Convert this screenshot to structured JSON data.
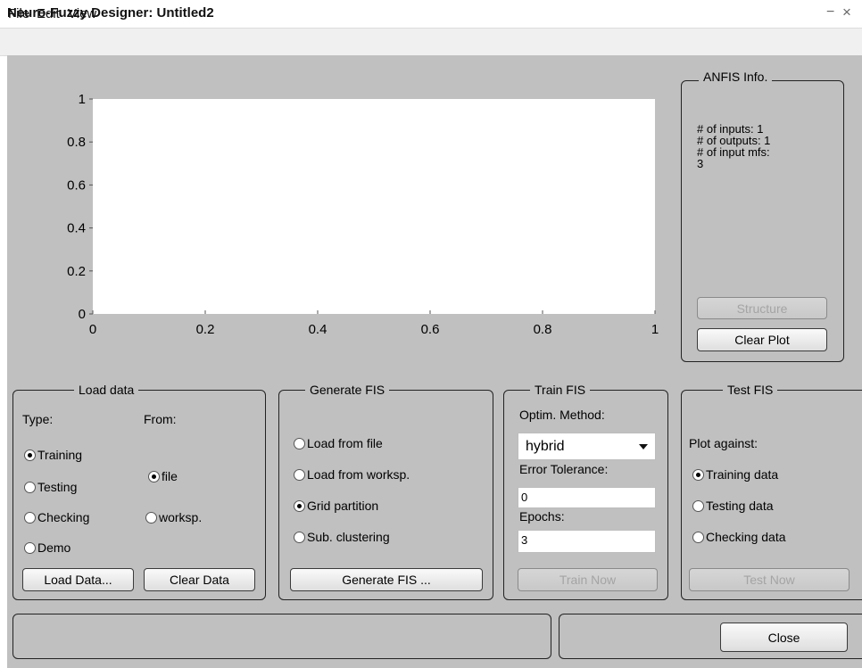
{
  "window": {
    "title": "Neuro-Fuzzy Designer: Untitled2",
    "min_glyph": "−",
    "close_glyph": "×"
  },
  "menu": [
    "File",
    "Edit",
    "View"
  ],
  "chart_data": {
    "type": "line",
    "series": [],
    "xlim": [
      0,
      1
    ],
    "ylim": [
      0,
      1
    ],
    "xticks": [
      "0",
      "0.2",
      "0.4",
      "0.6",
      "0.8",
      "1"
    ],
    "yticks": [
      "0",
      "0.2",
      "0.4",
      "0.6",
      "0.8",
      "1"
    ],
    "grid": false
  },
  "anfis_info": {
    "title": "ANFIS Info.",
    "lines": [
      "# of inputs: 1",
      "# of outputs: 1",
      "# of input mfs:",
      "3"
    ],
    "structure_button": "Structure",
    "clear_plot_button": "Clear Plot"
  },
  "load_data": {
    "title": "Load data",
    "type_label": "Type:",
    "from_label": "From:",
    "type_options": [
      {
        "label": "Training",
        "selected": true
      },
      {
        "label": "Testing",
        "selected": false
      },
      {
        "label": "Checking",
        "selected": false
      },
      {
        "label": "Demo",
        "selected": false
      }
    ],
    "from_options": [
      {
        "label": "file",
        "selected": true
      },
      {
        "label": "worksp.",
        "selected": false
      }
    ],
    "load_button": "Load Data...",
    "clear_button": "Clear Data"
  },
  "generate_fis": {
    "title": "Generate FIS",
    "options": [
      {
        "label": "Load from file",
        "selected": false
      },
      {
        "label": "Load from worksp.",
        "selected": false
      },
      {
        "label": "Grid partition",
        "selected": true
      },
      {
        "label": "Sub. clustering",
        "selected": false
      }
    ],
    "button": "Generate FIS ..."
  },
  "train_fis": {
    "title": "Train FIS",
    "optim_label": "Optim. Method:",
    "optim_value": "hybrid",
    "error_label": "Error Tolerance:",
    "error_value": "0",
    "epochs_label": "Epochs:",
    "epochs_value": "3",
    "button": "Train Now"
  },
  "test_fis": {
    "title": "Test FIS",
    "plot_against_label": "Plot against:",
    "options": [
      {
        "label": "Training data",
        "selected": true
      },
      {
        "label": "Testing data",
        "selected": false
      },
      {
        "label": "Checking data",
        "selected": false
      }
    ],
    "button": "Test Now"
  },
  "status": {
    "message": "",
    "close_button": "Close"
  }
}
